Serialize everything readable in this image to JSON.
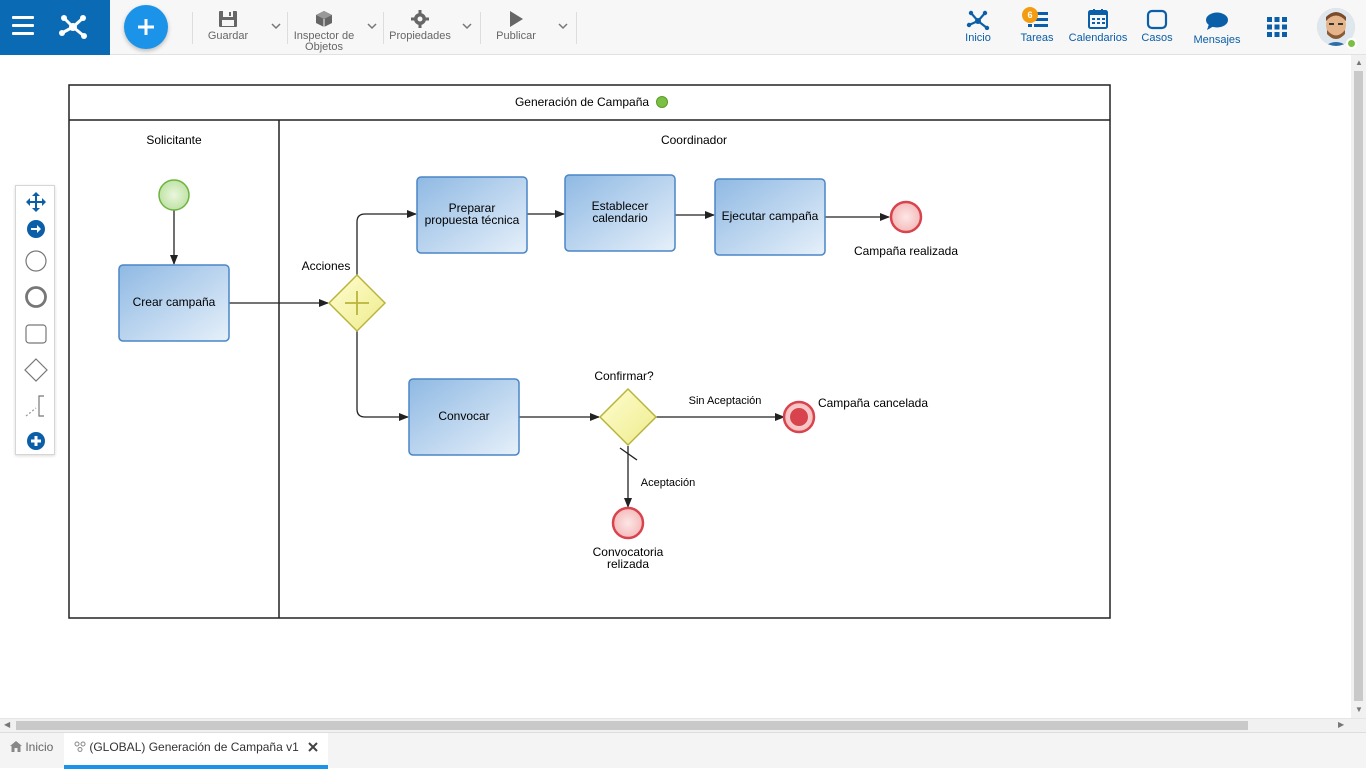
{
  "toolbar": {
    "save_label": "Guardar",
    "inspector_label_1": "Inspector de",
    "inspector_label_2": "Objetos",
    "properties_label": "Propiedades",
    "publish_label": "Publicar"
  },
  "nav": {
    "home_label": "Inicio",
    "tasks_label": "Tareas",
    "tasks_count": "6",
    "calendars_label": "Calendarios",
    "cases_label": "Casos",
    "messages_label": "Mensajes"
  },
  "diagram": {
    "pool_title": "Generación de Campaña",
    "lane_requester": "Solicitante",
    "lane_coordinator": "Coordinador",
    "task_create": "Crear campaña",
    "gateway_actions": "Acciones",
    "task_prepare_1": "Preparar",
    "task_prepare_2": "propuesta técnica",
    "task_schedule_1": "Establecer",
    "task_schedule_2": "calendario",
    "task_execute": "Ejecutar campaña",
    "end_done": "Campaña realizada",
    "task_summon": "Convocar",
    "gateway_confirm": "Confirmar?",
    "flow_rejected": "Sin Aceptación",
    "end_cancelled": "Campaña cancelada",
    "flow_accepted": "Aceptación",
    "end_summoned_1": "Convocatoria",
    "end_summoned_2": "relizada"
  },
  "tabs": {
    "home_label": "Inicio",
    "doc_label": "(GLOBAL) Generación de Campaña v1"
  },
  "colors": {
    "brand": "#0a6ab4",
    "accent": "#1a93e8",
    "task_fill": "#bcd6ef",
    "task_stroke": "#4a86c6",
    "gateway_fill": "#f7f6b6",
    "end_event": "#d9434d",
    "start_event": "#6db33f"
  }
}
